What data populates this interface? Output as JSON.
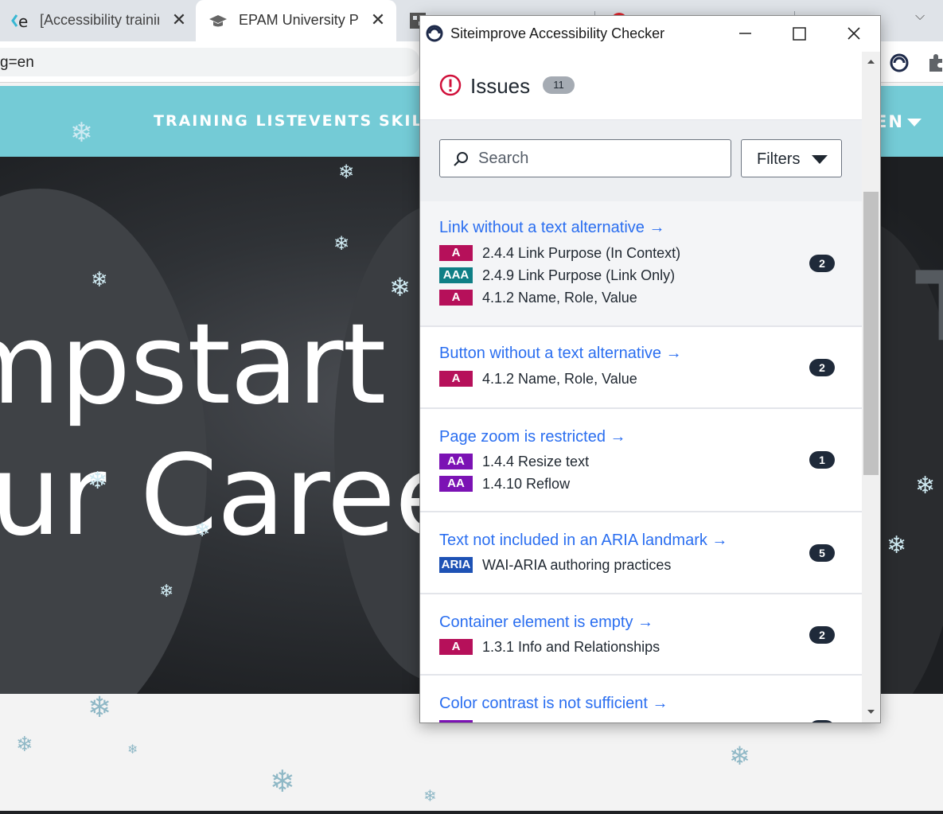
{
  "browser": {
    "tabs": [
      {
        "title": "[Accessibility trainin",
        "favicon": "epam-e-icon"
      },
      {
        "title": "EPAM University Pro",
        "favicon": "graduation-cap-icon"
      },
      {
        "title": "",
        "favicon": "puzzle-icon"
      },
      {
        "title": "",
        "favicon": "red-circle-icon"
      }
    ],
    "close_glyph": "✕",
    "url_fragment": "g=en",
    "overflow_glyph": "⌵"
  },
  "site": {
    "nav": [
      "TRAINING LIST",
      "EVENTS",
      "SKIL"
    ],
    "lang": "EN",
    "hero_line1": "mpstart &",
    "hero_line2": "ur Career",
    "hero_side_text": "TI"
  },
  "popup": {
    "title": "Siteimprove Accessibility Checker",
    "header": {
      "title": "Issues",
      "count": "11"
    },
    "search": {
      "placeholder": "Search"
    },
    "filters_label": "Filters",
    "issues": [
      {
        "title": "Link without a text alternative →",
        "count": "2",
        "criteria": [
          {
            "level": "A",
            "text": "2.4.4 Link Purpose (In Context)"
          },
          {
            "level": "AAA",
            "text": "2.4.9 Link Purpose (Link Only)"
          },
          {
            "level": "A",
            "text": "4.1.2 Name, Role, Value"
          }
        ]
      },
      {
        "title": "Button without a text alternative →",
        "count": "2",
        "criteria": [
          {
            "level": "A",
            "text": "4.1.2 Name, Role, Value"
          }
        ]
      },
      {
        "title": "Page zoom is restricted →",
        "count": "1",
        "criteria": [
          {
            "level": "AA",
            "text": "1.4.4 Resize text"
          },
          {
            "level": "AA",
            "text": "1.4.10 Reflow"
          }
        ]
      },
      {
        "title": "Text not included in an ARIA landmark →",
        "count": "5",
        "criteria": [
          {
            "level": "ARIA",
            "text": "WAI-ARIA authoring practices"
          }
        ]
      },
      {
        "title": "Container element is empty →",
        "count": "2",
        "criteria": [
          {
            "level": "A",
            "text": "1.3.1 Info and Relationships"
          }
        ]
      },
      {
        "title": "Color contrast is not sufficient →",
        "count": "",
        "criteria": [
          {
            "level": "AA",
            "text": ""
          }
        ]
      }
    ]
  },
  "colors": {
    "nav_bg": "#74cbd6",
    "link_blue": "#2a6ef0",
    "level_A": "#b6105a",
    "level_AA": "#7b12b4",
    "level_AAA": "#0f7f86",
    "level_ARIA": "#1e52b5",
    "issue_icon_red": "#d0103a",
    "siteimprove_navy": "#1e2a4a"
  }
}
